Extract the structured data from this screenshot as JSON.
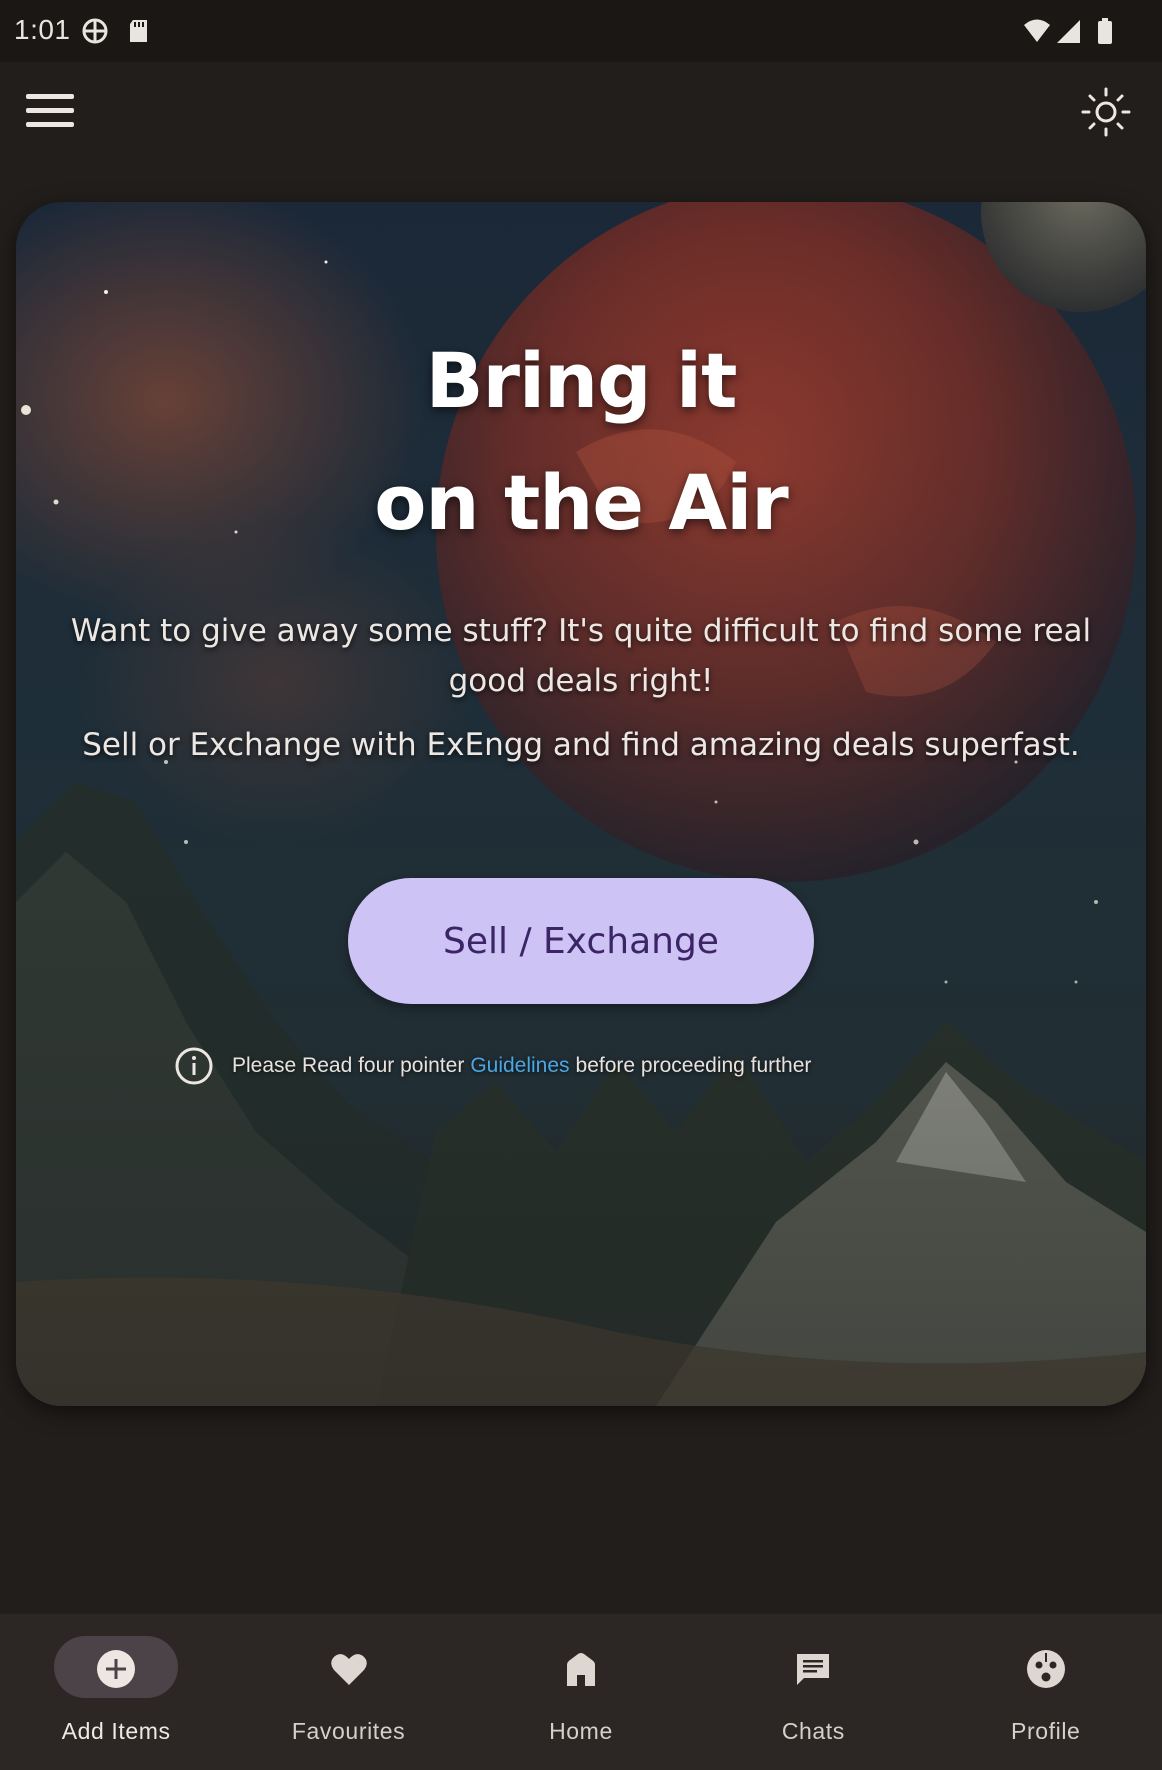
{
  "status_bar": {
    "time": "1:01",
    "left_icons": [
      "vpn-globe-icon",
      "sd-card-icon"
    ],
    "right_icons": [
      "wifi-icon",
      "signal-icon",
      "battery-icon"
    ]
  },
  "top_bar": {
    "menu_icon": "hamburger-menu-icon",
    "theme_icon": "sun-icon"
  },
  "hero": {
    "title_line1": "Bring it",
    "title_line2": "on the Air",
    "paragraph1": "Want to give away some stuff? It's quite difficult to find some real good deals right!",
    "paragraph2": "Sell or Exchange with ExEngg and find amazing deals superfast.",
    "button_label": "Sell / Exchange",
    "guideline_prefix": "Please Read four pointer",
    "guideline_link": "Guidelines",
    "guideline_suffix": "before proceeding further"
  },
  "bottom_nav": {
    "items": [
      {
        "label": "Add Items",
        "icon": "add-circle-icon",
        "active": true
      },
      {
        "label": "Favourites",
        "icon": "heart-icon",
        "active": false
      },
      {
        "label": "Home",
        "icon": "home-icon",
        "active": false
      },
      {
        "label": "Chats",
        "icon": "chat-icon",
        "active": false
      },
      {
        "label": "Profile",
        "icon": "profile-face-icon",
        "active": false
      }
    ]
  },
  "colors": {
    "background": "#221e1c",
    "button": "#cdc3f4",
    "button_text": "#3b2567",
    "link": "#4aa6e4",
    "nav_bar": "#2c2725",
    "nav_active_pill": "#4c4348"
  }
}
